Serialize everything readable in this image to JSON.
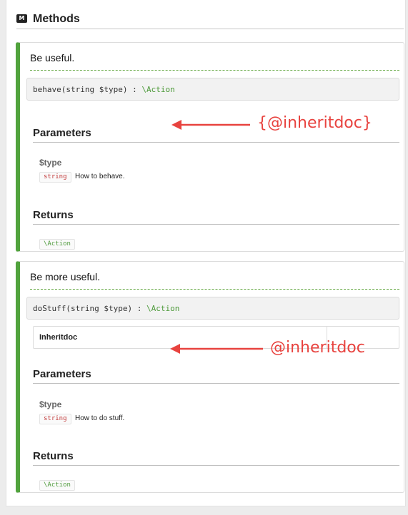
{
  "section": {
    "title": "Methods",
    "icon": "M"
  },
  "methods": [
    {
      "summary": "Be useful.",
      "signature": {
        "name_params": "behave(string $type) : ",
        "return_type": "\\Action"
      },
      "parameters_heading": "Parameters",
      "param": {
        "name": "$type",
        "type": "string",
        "description": "How to behave."
      },
      "returns_heading": "Returns",
      "return_badge": "\\Action"
    },
    {
      "summary": "Be more useful.",
      "signature": {
        "name_params": "doStuff(string $type) : ",
        "return_type": "\\Action"
      },
      "inheritdoc_label": "Inheritdoc",
      "parameters_heading": "Parameters",
      "param": {
        "name": "$type",
        "type": "string",
        "description": "How to do stuff."
      },
      "returns_heading": "Returns",
      "return_badge": "\\Action"
    }
  ],
  "annotations": {
    "first": "{@inheritdoc}",
    "second": "@inheritdoc",
    "color": "#e8433f"
  },
  "colors": {
    "accent": "#51a33d",
    "type_string": "#c23a3a",
    "return_type": "#4d9a3a"
  }
}
